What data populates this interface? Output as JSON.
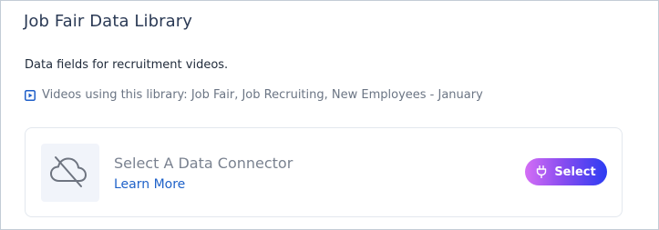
{
  "library": {
    "title": "Job Fair Data Library",
    "description": "Data fields for recruitment videos.",
    "videos_text": "Videos using this library: Job Fair, Job Recruiting, New Employees - January"
  },
  "connector": {
    "title": "Select A Data Connector",
    "learn_more": "Learn More",
    "select_label": "Select",
    "thumb_icon": "cloud-off-icon",
    "button_icon": "plug-icon"
  },
  "colors": {
    "title": "#2b3a55",
    "link": "#1f62c9",
    "button_gradient_start": "#d46ef5",
    "button_gradient_end": "#2c3cf2",
    "video_icon": "#1f5fc9"
  }
}
